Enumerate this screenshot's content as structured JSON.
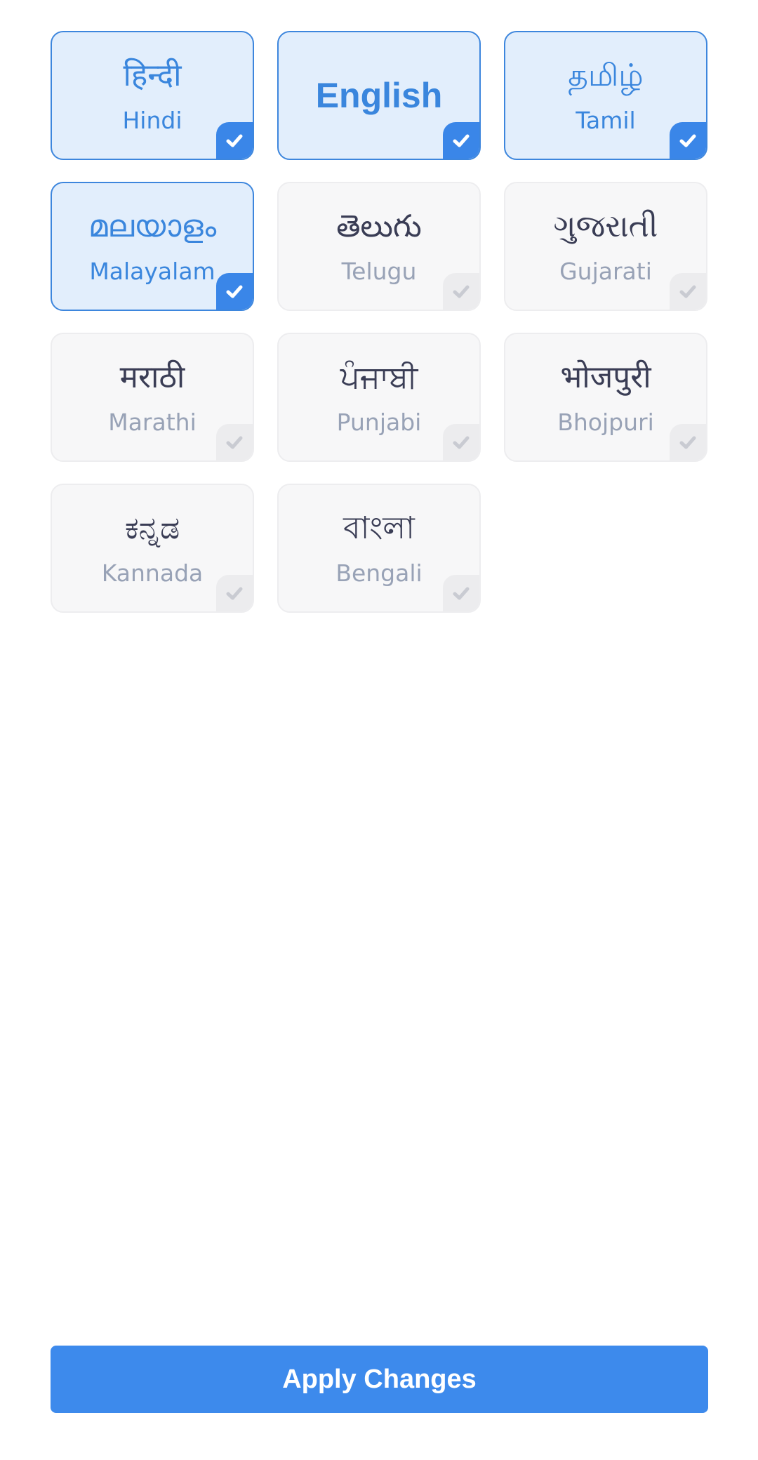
{
  "languages": [
    {
      "native": "हिन्दी",
      "english": "Hindi",
      "selected": true
    },
    {
      "native": "English",
      "english": "",
      "selected": true
    },
    {
      "native": "தமிழ்",
      "english": "Tamil",
      "selected": true
    },
    {
      "native": "മലയാളം",
      "english": "Malayalam",
      "selected": true
    },
    {
      "native": "తెలుగు",
      "english": "Telugu",
      "selected": false
    },
    {
      "native": "ગુજરાતી",
      "english": "Gujarati",
      "selected": false
    },
    {
      "native": "मराठी",
      "english": "Marathi",
      "selected": false
    },
    {
      "native": "ਪੰਜਾਬੀ",
      "english": "Punjabi",
      "selected": false
    },
    {
      "native": "भोजपुरी",
      "english": "Bhojpuri",
      "selected": false
    },
    {
      "native": "ಕನ್ನಡ",
      "english": "Kannada",
      "selected": false
    },
    {
      "native": "বাংলা",
      "english": "Bengali",
      "selected": false
    }
  ],
  "apply_label": "Apply Changes",
  "icons": {
    "tile_check": "checkmark-icon"
  },
  "colors": {
    "accent": "#3d8aec",
    "selected_bg": "#e2eefc",
    "selected_border": "#3d86dd",
    "unselected_bg": "#f7f7f8",
    "native_text": "#3a3d55",
    "secondary_text": "#98a2b6"
  }
}
